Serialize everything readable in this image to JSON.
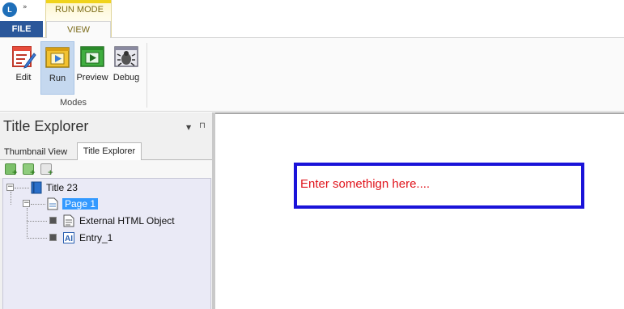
{
  "app": {
    "logo_text": "L",
    "quick_access_more": "»"
  },
  "ribbon": {
    "contextual_group": "RUN MODE",
    "tabs": {
      "file": "FILE",
      "view": "VIEW"
    },
    "buttons": {
      "edit": "Edit",
      "run": "Run",
      "preview": "Preview",
      "debug": "Debug"
    },
    "group_label": "Modes"
  },
  "panel": {
    "title": "Title Explorer",
    "dropdown_glyph": "▼",
    "pin_glyph": "⊓",
    "tabs": {
      "thumbnail": "Thumbnail View",
      "explorer": "Title Explorer"
    }
  },
  "tree": {
    "title": "Title 23",
    "page": "Page 1",
    "objects": [
      "External HTML Object",
      "Entry_1"
    ]
  },
  "canvas": {
    "entry_text": "Enter somethign here...."
  },
  "colors": {
    "file_tab": "#2b579a",
    "selection": "#3399ff",
    "entry_border": "#1a13d9",
    "entry_text": "#e0141c"
  }
}
